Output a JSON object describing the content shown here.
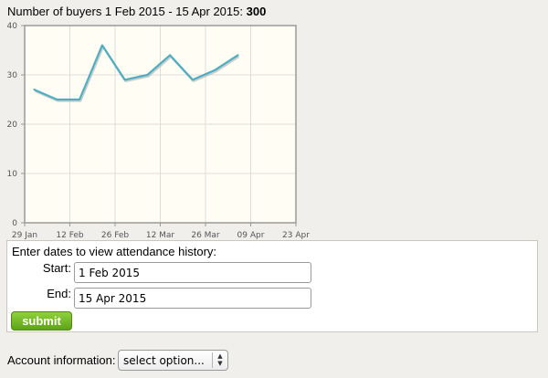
{
  "headline": {
    "prefix": "Number of buyers 1 Feb 2015 - 15 Apr 2015:",
    "count": "300"
  },
  "chart_data": {
    "type": "line",
    "x_dates": [
      "2015-02-01",
      "2015-02-08",
      "2015-02-15",
      "2015-02-22",
      "2015-03-01",
      "2015-03-08",
      "2015-03-15",
      "2015-03-22",
      "2015-03-29",
      "2015-04-05",
      "2015-04-12"
    ],
    "values": [
      27,
      25,
      25,
      36,
      29,
      30,
      34,
      29,
      31,
      34
    ],
    "x_ticks": [
      "29 Jan",
      "12 Feb",
      "26 Feb",
      "12 Mar",
      "26 Mar",
      "09 Apr",
      "23 Apr"
    ],
    "x_tick_dates": [
      "2015-01-29",
      "2015-02-12",
      "2015-02-26",
      "2015-03-12",
      "2015-03-26",
      "2015-04-09",
      "2015-04-23"
    ],
    "y_ticks": [
      "0",
      "10",
      "20",
      "30",
      "40"
    ],
    "xlim": [
      "2015-01-29",
      "2015-04-23"
    ],
    "ylim": [
      0,
      40
    ],
    "grid": true,
    "colors": {
      "line": "#4eaec3",
      "shadow": "#b8b8b8",
      "plot_bg": "#fffdf4",
      "grid": "#dddddd",
      "frame": "#9a9a9a"
    }
  },
  "form": {
    "title": "Enter dates to view attendance history:",
    "start_label": "Start:",
    "start_value": "1 Feb 2015",
    "end_label": "End:",
    "end_value": "15 Apr 2015",
    "submit_label": "submit"
  },
  "account": {
    "label": "Account information:",
    "selected": "select option..."
  },
  "icons": {
    "select_arrows": "updown-chevron-icon"
  }
}
